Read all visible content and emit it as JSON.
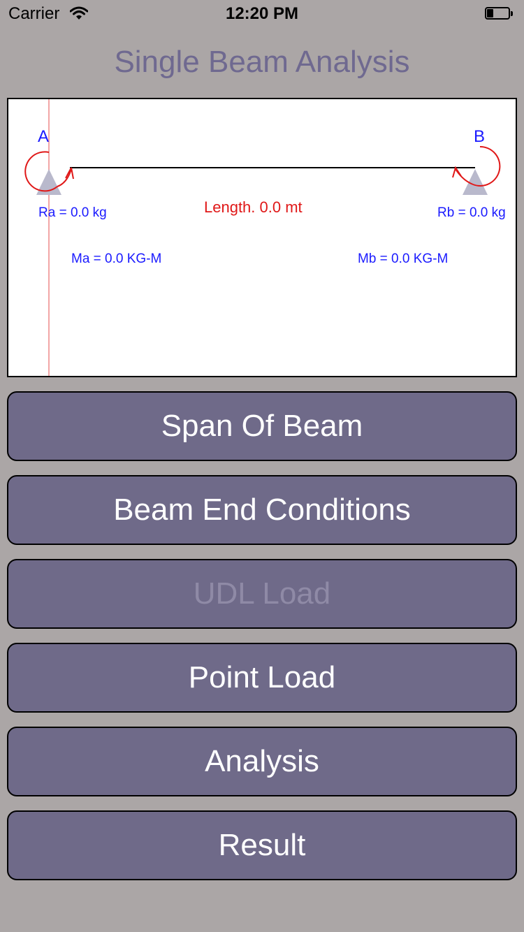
{
  "status_bar": {
    "carrier": "Carrier",
    "time": "12:20 PM",
    "battery_level": 0.3
  },
  "title": "Single Beam Analysis",
  "diagram": {
    "support_a_label": "A",
    "support_b_label": "B",
    "ra_text": "Ra = 0.0 kg",
    "rb_text": "Rb = 0.0 kg",
    "length_text": "Length. 0.0 mt",
    "ma_text": "Ma = 0.0 KG-M",
    "mb_text": "Mb = 0.0 KG-M",
    "colors": {
      "labels": "#1a1aff",
      "moment_arrows": "#e01818",
      "supports": "#b9b9cc",
      "beam": "#000000"
    }
  },
  "buttons": {
    "span": "Span Of Beam",
    "end_conditions": "Beam End Conditions",
    "udl": "UDL Load",
    "point": "Point Load",
    "analysis": "Analysis",
    "result": "Result"
  },
  "colors": {
    "background": "#aba6a6",
    "title": "#6f6990",
    "button_bg": "#6f6a89",
    "button_text": "#ffffff",
    "button_disabled_text": "#8f8aa6"
  }
}
